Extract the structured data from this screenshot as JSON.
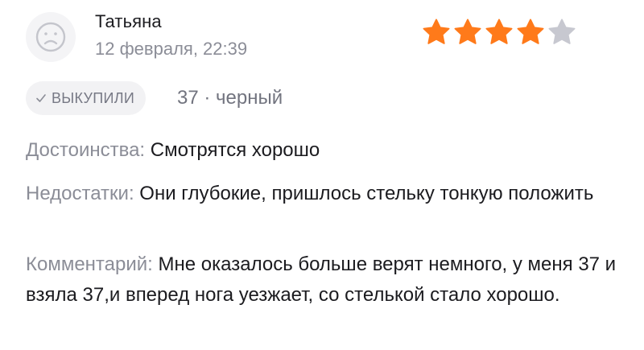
{
  "review": {
    "author": {
      "name": "Татьяна",
      "avatar_icon": "sad-face-icon"
    },
    "date": "12 февраля, 22:39",
    "rating": {
      "value": 4,
      "max": 5,
      "filled_color": "#ff7a1a",
      "empty_color": "#c7c8d0"
    },
    "badge": {
      "icon": "check-icon",
      "label": "ВЫКУПИЛИ"
    },
    "variant": "37 · черный",
    "pros": {
      "label": "Достоинства:",
      "text": "Смотрятся хорошо"
    },
    "cons": {
      "label": "Недостатки:",
      "text": "Они глубокие, пришлось стельку тонкую положить"
    },
    "comment": {
      "label": "Комментарий:",
      "text": "Мне оказалось больше верят немного, у меня 37 и взяла 37,и вперед нога уезжает, со стелькой стало хорошо."
    }
  }
}
